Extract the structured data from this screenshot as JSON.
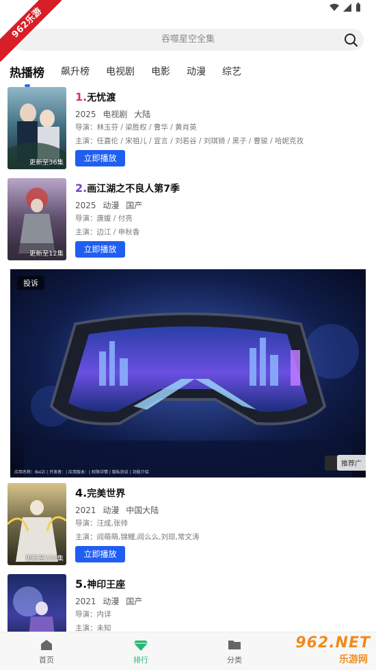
{
  "corner_ribbon": "962乐游",
  "search": {
    "placeholder": "吞噬星空全集"
  },
  "tabs": [
    {
      "label": "热播榜",
      "active": true
    },
    {
      "label": "飙升榜"
    },
    {
      "label": "电视剧"
    },
    {
      "label": "电影"
    },
    {
      "label": "动漫"
    },
    {
      "label": "综艺"
    }
  ],
  "items": [
    {
      "rank": "1.",
      "title": "无忧渡",
      "year": "2025",
      "type": "电视剧",
      "region": "大陆",
      "director": "导演：林玉芬 / 梁胜权 / 曹华 / 黄肖英",
      "cast": "主演：任嘉伦 / 宋祖儿 / 宣言 / 刘若谷 / 刘琪锜 / 黑子 / 曹骏 / 哈妮克孜",
      "badge": "更新至36集",
      "play_label": "立即播放"
    },
    {
      "rank": "2.",
      "title": "画江湖之不良人第7季",
      "year": "2025",
      "type": "动漫",
      "region": "国产",
      "director": "导演：唐媛 / 付亮",
      "cast": "主演：边江 / 申秋香",
      "badge": "更新至12集",
      "play_label": "立即播放"
    },
    {
      "rank": "4.",
      "title": "完美世界",
      "year": "2021",
      "type": "动漫",
      "region": "中国大陆",
      "director": "导演：汪成,张帅",
      "cast": "主演：阎萌萌,锦鲤,阎么么,刘琮,常文涛",
      "badge": "更新至232集",
      "play_label": "立即播放"
    },
    {
      "rank": "5.",
      "title": "神印王座",
      "year": "2021",
      "type": "动漫",
      "region": "国产",
      "director": "导演：内详",
      "cast": "主演：未知"
    }
  ],
  "ad": {
    "report_label": "投诉",
    "recommend_label": "推荐广",
    "footer": "应用名称：BeiZi | 开发者：| 应用版本：| 权限详情 | 隐私协议 | 功能介绍"
  },
  "bottom_nav": [
    {
      "label": "首页",
      "icon": "home-icon"
    },
    {
      "label": "排行",
      "icon": "diamond-icon",
      "active": true
    },
    {
      "label": "分类",
      "icon": "folder-icon"
    }
  ],
  "watermark": {
    "top": "962.NET",
    "bottom": "乐游网"
  },
  "colors": {
    "accent": "#1f5ef0",
    "active_nav": "#29b874",
    "rank1": "#d6336c",
    "rank2": "#6f42c1"
  }
}
